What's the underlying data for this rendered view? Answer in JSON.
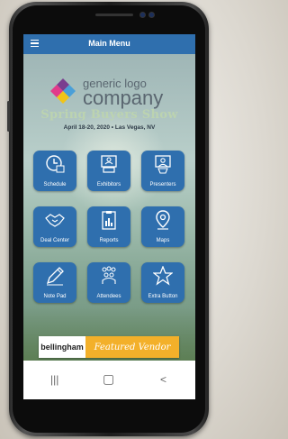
{
  "header": {
    "title": "Main Menu",
    "menu_icon": "hamburger-menu-icon"
  },
  "banner": {
    "logo_line1": "generic logo",
    "logo_line2": "company",
    "show_name": "Spring Buyers Show",
    "show_date": "April 18-20, 2020 • Las Vegas, NV"
  },
  "tiles": [
    {
      "label": "Schedule",
      "icon": "clock-calendar-icon"
    },
    {
      "label": "Exhibitors",
      "icon": "exhibitor-booth-icon"
    },
    {
      "label": "Presenters",
      "icon": "presenter-podium-icon"
    },
    {
      "label": "Deal Center",
      "icon": "handshake-icon"
    },
    {
      "label": "Reports",
      "icon": "clipboard-chart-icon"
    },
    {
      "label": "Maps",
      "icon": "map-pin-icon"
    },
    {
      "label": "Note Pad",
      "icon": "pencil-icon"
    },
    {
      "label": "Attendees",
      "icon": "people-group-icon"
    },
    {
      "label": "Extra Button",
      "icon": "star-icon"
    }
  ],
  "vendor": {
    "brand": "bellingham",
    "tagline": "Featured Vendor"
  },
  "navbar": {
    "recent": "|||",
    "home": "▢",
    "back": "<"
  },
  "colors": {
    "tile": "#2f6fae",
    "header": "#2f6fae",
    "vendor_accent": "#f3b02a"
  }
}
